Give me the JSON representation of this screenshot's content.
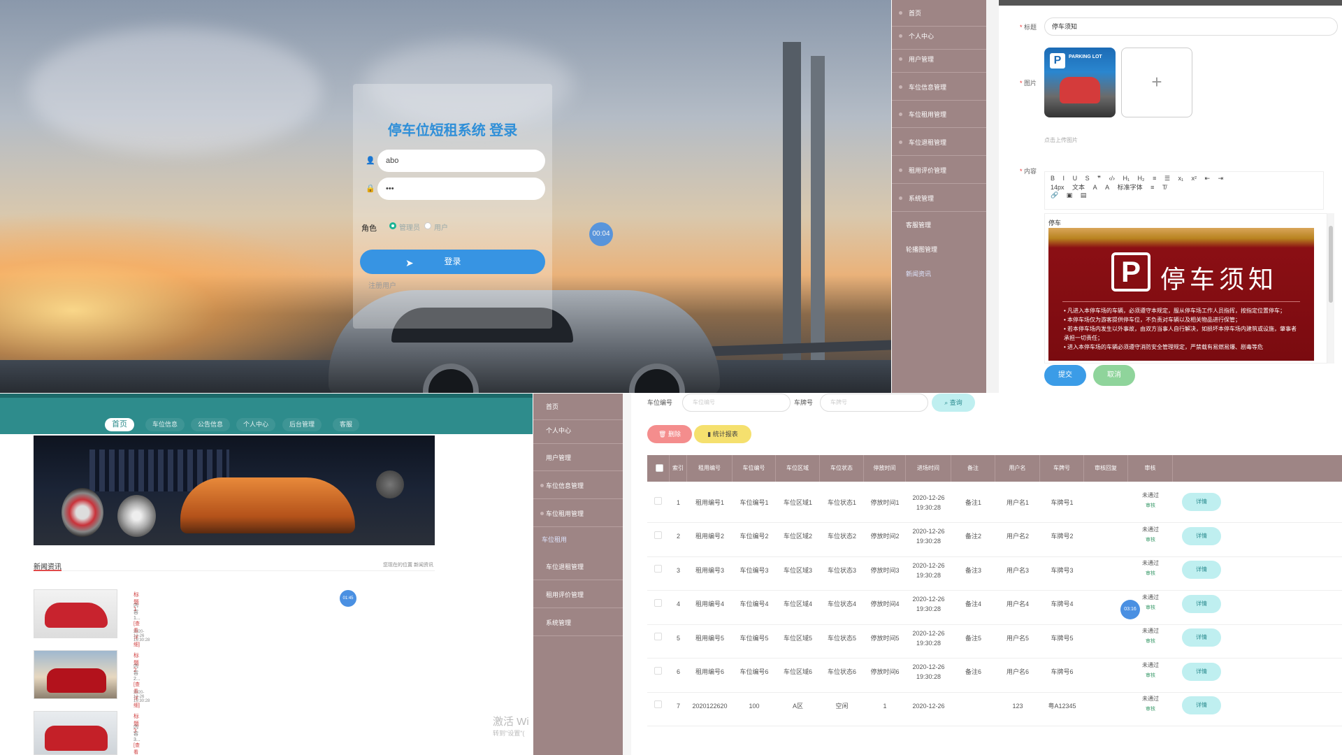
{
  "login": {
    "title": "停车位短租系统 登录",
    "username": "abo",
    "password": "•••",
    "role_label": "角色",
    "role_admin": "管理员",
    "role_user": "用户",
    "login_button": "登录",
    "register_link": "注册用户",
    "timer": "00:04"
  },
  "sidebar_top": {
    "items": [
      "首页",
      "个人中心",
      "用户管理",
      "车位信息管理",
      "车位租用管理",
      "车位退租管理",
      "租用评价管理",
      "系统管理",
      "客服管理",
      "轮播图管理",
      "新闻资讯"
    ]
  },
  "editor": {
    "title_label": "标题",
    "title_value": "停车须知",
    "image_label": "图片",
    "upload_hint": "点击上传图片",
    "content_label": "内容",
    "toolbar": [
      "B",
      "I",
      "U",
      "S",
      "❞",
      "‹/›",
      "H₁",
      "H₂",
      "≡",
      "☰",
      "x₁",
      "x²",
      "⇤",
      "⇥"
    ],
    "toolbar2": [
      "14px",
      "文本",
      "A",
      "A",
      "标准字体",
      "≡",
      "T̸"
    ],
    "toolbar3": [
      "🔗",
      "▣",
      "▤"
    ],
    "body_word": "停车",
    "poster_title": "停车须知",
    "poster_lines": [
      "• 凡进入本停车场的车辆，必须遵守本规定，服从停车场工作人员指挥，按指定位置停车；",
      "• 本停车场仅为游客提供停车位，不负责对车辆以及相关物品进行保管；",
      "• 若本停车场内发生以外事故，由双方当事人自行解决，如损坏本停车场内建筑或设施，肇事者承担一切责任；",
      "• 进入本停车场的车辆必须遵守消防安全管理规定，严禁载有易燃易爆、剧毒等危"
    ],
    "submit": "提交",
    "cancel": "取消"
  },
  "front": {
    "nav": [
      "首页",
      "车位信息",
      "公告信息",
      "个人中心",
      "后台管理",
      "客服"
    ],
    "news_title": "新闻资讯",
    "crumb": "您现在的位置  新闻资讯",
    "items": [
      {
        "title": "标题1",
        "content": "内容1...",
        "tag": "[查看详细]",
        "time": "2020-12-26 19:30:28"
      },
      {
        "title": "标题2",
        "content": "内容2...",
        "tag": "[查看详细]",
        "time": "2020-12-26 19:30:28"
      },
      {
        "title": "标题3",
        "content": "内容3...",
        "tag": "[查看详细]",
        "time": ""
      }
    ],
    "timer": "01:45",
    "watermark1": "激活 Wi",
    "watermark2": "转到\"设置\"("
  },
  "sidebar_bottom": {
    "items": [
      "首页",
      "个人中心",
      "用户管理",
      "车位信息管理",
      "车位租用管理",
      "车位租用",
      "车位退租管理",
      "租用评价管理",
      "系统管理"
    ]
  },
  "table": {
    "search_label1": "车位编号",
    "search_ph1": "车位编号",
    "search_label2": "车牌号",
    "search_ph2": "车牌号",
    "query": "查询",
    "delete": "删除",
    "stats": "统计报表",
    "headers": [
      "索引",
      "租用编号",
      "车位编号",
      "车位区域",
      "车位状态",
      "停放时间",
      "进场时间",
      "备注",
      "用户名",
      "车牌号",
      "审核回复",
      "审核"
    ],
    "rows": [
      {
        "idx": "1",
        "rent": "租用编号1",
        "spot": "车位编号1",
        "area": "车位区域1",
        "state": "车位状态1",
        "park": "停放时间1",
        "time": "2020-12-26\n19:30:28",
        "note": "备注1",
        "user": "用户名1",
        "plate": "车牌号1"
      },
      {
        "idx": "2",
        "rent": "租用编号2",
        "spot": "车位编号2",
        "area": "车位区域2",
        "state": "车位状态2",
        "park": "停放时间2",
        "time": "2020-12-26\n19:30:28",
        "note": "备注2",
        "user": "用户名2",
        "plate": "车牌号2"
      },
      {
        "idx": "3",
        "rent": "租用编号3",
        "spot": "车位编号3",
        "area": "车位区域3",
        "state": "车位状态3",
        "park": "停放时间3",
        "time": "2020-12-26\n19:30:28",
        "note": "备注3",
        "user": "用户名3",
        "plate": "车牌号3"
      },
      {
        "idx": "4",
        "rent": "租用编号4",
        "spot": "车位编号4",
        "area": "车位区域4",
        "state": "车位状态4",
        "park": "停放时间4",
        "time": "2020-12-26\n19:30:28",
        "note": "备注4",
        "user": "用户名4",
        "plate": "车牌号4"
      },
      {
        "idx": "5",
        "rent": "租用编号5",
        "spot": "车位编号5",
        "area": "车位区域5",
        "state": "车位状态5",
        "park": "停放时间5",
        "time": "2020-12-26\n19:30:28",
        "note": "备注5",
        "user": "用户名5",
        "plate": "车牌号5"
      },
      {
        "idx": "6",
        "rent": "租用编号6",
        "spot": "车位编号6",
        "area": "车位区域6",
        "state": "车位状态6",
        "park": "停放时间6",
        "time": "2020-12-26\n19:30:28",
        "note": "备注6",
        "user": "用户名6",
        "plate": "车牌号6"
      },
      {
        "idx": "7",
        "rent": "2020122620",
        "spot": "100",
        "area": "A区",
        "state": "空闲",
        "park": "1",
        "time": "2020-12-26",
        "note": "",
        "user": "123",
        "plate": "粤A12345"
      }
    ],
    "audit_status": "未通过",
    "audit_action": "审核",
    "detail": "详情",
    "timer": "03:16"
  }
}
